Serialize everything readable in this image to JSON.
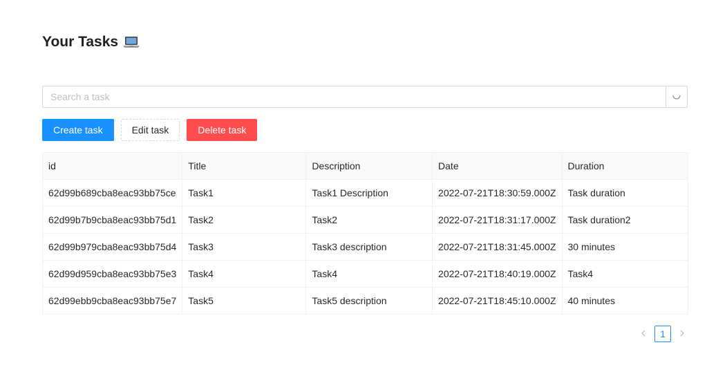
{
  "page": {
    "title": "Your Tasks",
    "title_icon": "laptop-icon"
  },
  "search": {
    "placeholder": "Search a task",
    "value": "",
    "icon": "loading-spinner-icon"
  },
  "actions": {
    "create_label": "Create task",
    "edit_label": "Edit task",
    "delete_label": "Delete task"
  },
  "table": {
    "columns": [
      "id",
      "Title",
      "Description",
      "Date",
      "Duration"
    ],
    "rows": [
      [
        "62d99b689cba8eac93bb75ce",
        "Task1",
        "Task1 Description",
        "2022-07-21T18:30:59.000Z",
        "Task duration"
      ],
      [
        "62d99b7b9cba8eac93bb75d1",
        "Task2",
        "Task2",
        "2022-07-21T18:31:17.000Z",
        "Task duration2"
      ],
      [
        "62d99b979cba8eac93bb75d4",
        "Task3",
        "Task3 description",
        "2022-07-21T18:31:45.000Z",
        "30 minutes"
      ],
      [
        "62d99d959cba8eac93bb75e3",
        "Task4",
        "Task4",
        "2022-07-21T18:40:19.000Z",
        "Task4"
      ],
      [
        "62d99ebb9cba8eac93bb75e7",
        "Task5",
        "Task5 description",
        "2022-07-21T18:45:10.000Z",
        "40 minutes"
      ]
    ]
  },
  "pagination": {
    "current_page": "1"
  },
  "colors": {
    "primary": "#1890ff",
    "danger": "#ff4d4f",
    "border": "#d9d9d9"
  }
}
